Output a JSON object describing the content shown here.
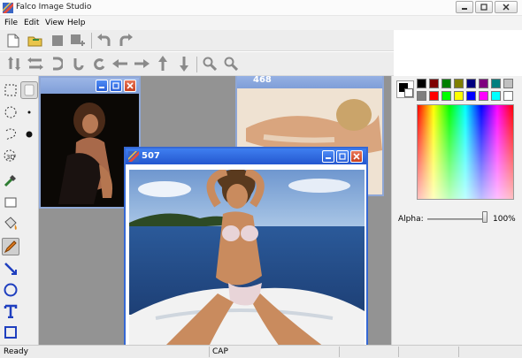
{
  "window": {
    "title": "Falco Image Studio"
  },
  "menu": [
    "File",
    "Edit",
    "View",
    "Help"
  ],
  "child_windows": [
    {
      "title": ""
    },
    {
      "title": "468"
    },
    {
      "title": "507"
    }
  ],
  "right_panel": {
    "swatches": [
      "#000000",
      "#7f0000",
      "#007f00",
      "#7f7f00",
      "#00007f",
      "#7f007f",
      "#007f7f",
      "#c0c0c0",
      "#7f7f7f",
      "#ff0000",
      "#00ff00",
      "#ffff00",
      "#0000ff",
      "#ff00ff",
      "#00ffff",
      "#ffffff"
    ],
    "alpha_label": "Alpha:",
    "alpha_value": "100%",
    "alpha_fraction": 1.0
  },
  "status": {
    "left": "Ready",
    "middle": "CAP"
  },
  "colors": {
    "titlebar_active": "#2457cf",
    "workspace": "#939393"
  }
}
